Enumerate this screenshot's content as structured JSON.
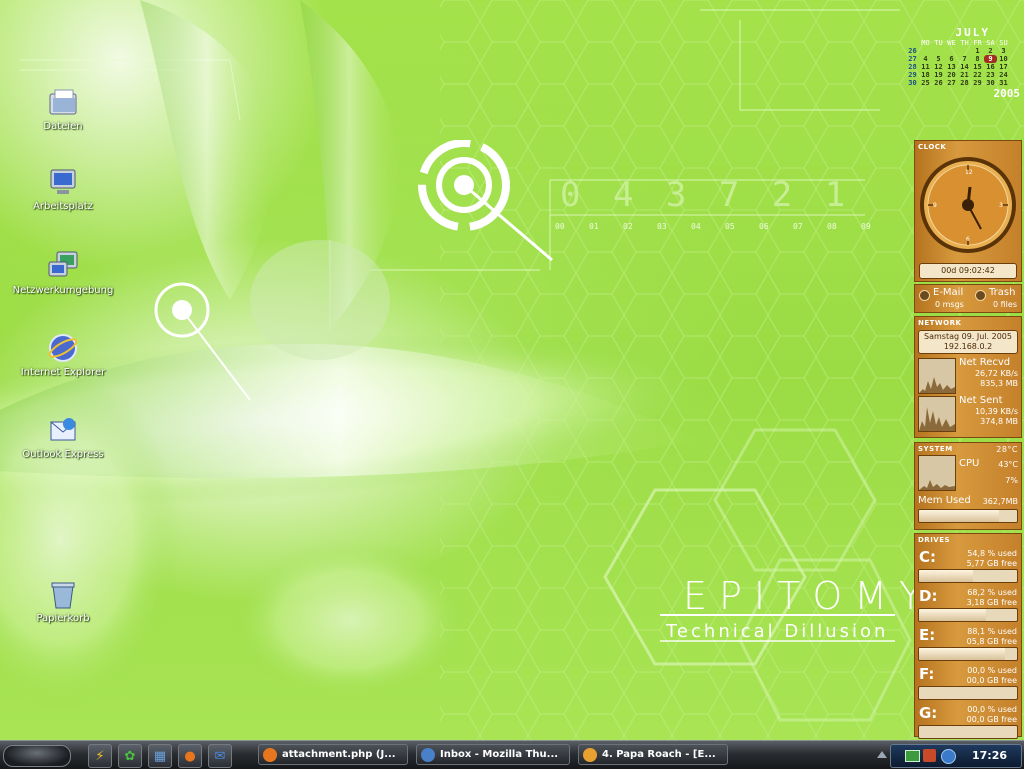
{
  "desktop_icons": [
    {
      "label": "Dateien",
      "icon": "folder-documents-icon"
    },
    {
      "label": "Arbeitsplatz",
      "icon": "my-computer-icon"
    },
    {
      "label": "Netzwerkumgebung",
      "icon": "network-icon"
    },
    {
      "label": "Internet Explorer",
      "icon": "internet-explorer-icon"
    },
    {
      "label": "Outlook Express",
      "icon": "outlook-express-icon"
    },
    {
      "label": "Papierkorb",
      "icon": "recycle-bin-icon"
    }
  ],
  "wallpaper": {
    "title": "EPITOMY",
    "subtitle": "Technical Dillusion",
    "digits": "0 4 3 7 2 1",
    "scale": [
      "00",
      "01",
      "02",
      "03",
      "04",
      "05",
      "06",
      "07",
      "08",
      "09"
    ]
  },
  "calendar": {
    "month": "JULY",
    "weekdays": [
      "MO",
      "TU",
      "WE",
      "TH",
      "FR",
      "SA",
      "SU"
    ],
    "weeks": [
      {
        "wk": "26",
        "days": [
          "",
          "",
          "",
          "",
          "1",
          "2",
          "3"
        ]
      },
      {
        "wk": "27",
        "days": [
          "4",
          "5",
          "6",
          "7",
          "8",
          "9",
          "10"
        ]
      },
      {
        "wk": "28",
        "days": [
          "11",
          "12",
          "13",
          "14",
          "15",
          "16",
          "17"
        ]
      },
      {
        "wk": "29",
        "days": [
          "18",
          "19",
          "20",
          "21",
          "22",
          "23",
          "24"
        ]
      },
      {
        "wk": "30",
        "days": [
          "25",
          "26",
          "27",
          "28",
          "29",
          "30",
          "31"
        ]
      }
    ],
    "today": "9",
    "year": "2005"
  },
  "clock": {
    "title": "CLOCK",
    "time": "00d 09:02:42",
    "numbers": [
      "12",
      "3",
      "6",
      "9"
    ]
  },
  "mail": {
    "email_label": "E-Mail",
    "email_count": "0 msgs",
    "trash_label": "Trash",
    "trash_count": "0 files"
  },
  "network": {
    "title": "NETWORK",
    "date": "Samstag 09. Jul. 2005",
    "ip": "192.168.0.2",
    "recv_label": "Net Recvd",
    "recv_rate": "26,72 KB/s",
    "recv_total": "835,3 MB",
    "sent_label": "Net Sent",
    "sent_rate": "10,39 KB/s",
    "sent_total": "374,8 MB"
  },
  "system": {
    "title": "SYSTEM",
    "temp": "28°C",
    "cpu_label": "CPU",
    "cpu_temp": "43°C",
    "cpu_load": "7%",
    "mem_label": "Mem Used",
    "mem_value": "362,7MB",
    "mem_fraction": 0.82
  },
  "drives": {
    "title": "DRIVES",
    "items": [
      {
        "letter": "C:",
        "used": "54,8 % used",
        "free": "5,77 GB free",
        "fraction": 0.548
      },
      {
        "letter": "D:",
        "used": "68,2 % used",
        "free": "3,18 GB free",
        "fraction": 0.682
      },
      {
        "letter": "E:",
        "used": "88,1 % used",
        "free": "05,8 GB free",
        "fraction": 0.881
      },
      {
        "letter": "F:",
        "used": "00,0 % used",
        "free": "00,0 GB free",
        "fraction": 0.0
      },
      {
        "letter": "G:",
        "used": "00,0 % used",
        "free": "00,0 GB free",
        "fraction": 0.0
      }
    ]
  },
  "taskbar": {
    "quicklaunch": [
      "lightning-icon",
      "icq-icon",
      "desktop-icon",
      "firefox-icon",
      "outlook-icon"
    ],
    "tasks": [
      {
        "label": "attachment.php (J...",
        "icon": "firefox-icon",
        "color": "#e8761e"
      },
      {
        "label": "Inbox - Mozilla Thu...",
        "icon": "thunderbird-icon",
        "color": "#4a80c8"
      },
      {
        "label": "4. Papa Roach - [E...",
        "icon": "winamp-icon",
        "color": "#e8a030"
      }
    ],
    "tray_icons": [
      "mail-icon",
      "security-icon",
      "messenger-icon"
    ],
    "time": "17:26"
  },
  "colors": {
    "accent": "#c8822a",
    "wallpaper": "#a4e24b",
    "taskbar": "#2a2d31"
  }
}
